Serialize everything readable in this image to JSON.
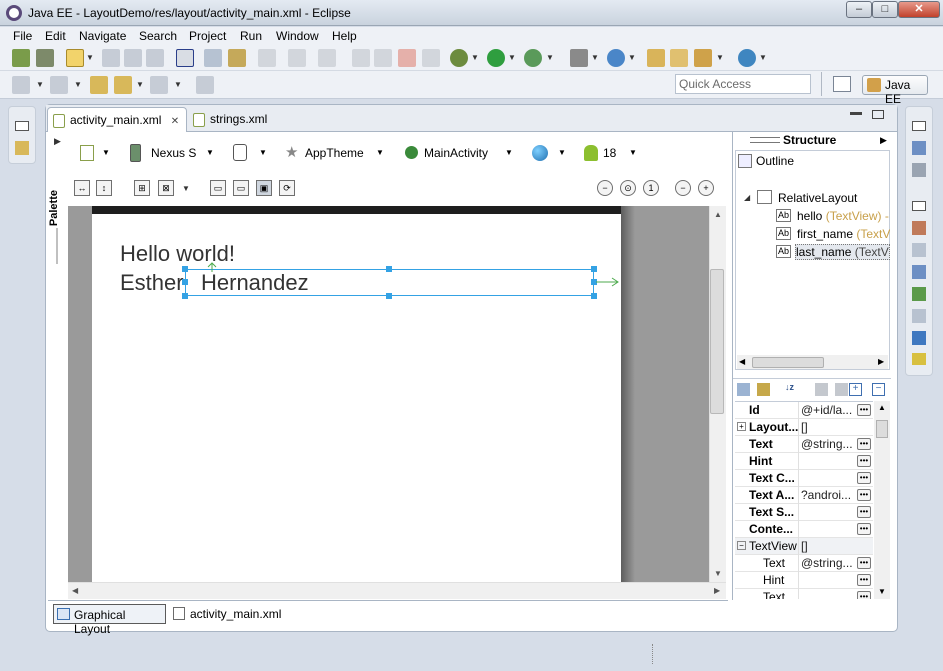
{
  "window": {
    "title": "Java EE - LayoutDemo/res/layout/activity_main.xml - Eclipse",
    "minimize": "–",
    "maximize": "□",
    "close": "✕"
  },
  "menu": [
    "File",
    "Edit",
    "Navigate",
    "Search",
    "Project",
    "Run",
    "Window",
    "Help"
  ],
  "toolbar": {
    "quick_access_placeholder": "Quick Access",
    "perspective": "Java EE"
  },
  "editor_tabs": [
    {
      "label": "activity_main.xml",
      "close": "✕"
    },
    {
      "label": "strings.xml"
    }
  ],
  "palette_label": "Palette",
  "config_bar": {
    "device": "Nexus S",
    "theme": "AppTheme",
    "activity": "MainActivity",
    "api_level": "18"
  },
  "canvas": {
    "hello": "Hello world!",
    "first_name": "Esther",
    "last_name": "Hernandez"
  },
  "bottom_tabs": [
    "Graphical Layout",
    "activity_main.xml"
  ],
  "structure": {
    "title": "Structure",
    "outline_title": "Outline",
    "root": "RelativeLayout",
    "children": [
      {
        "id": "hello",
        "type": "(TextView) -"
      },
      {
        "id": "first_name",
        "type": "(TextVi"
      },
      {
        "id": "last_name",
        "type": "(TextVi"
      }
    ]
  },
  "properties": [
    {
      "name": "Id",
      "value": "@+id/la...",
      "btn": true
    },
    {
      "name": "Layout...",
      "value": "[]",
      "expand": true
    },
    {
      "name": "Text",
      "value": "@string...",
      "btn": true
    },
    {
      "name": "Hint",
      "value": "",
      "btn": true
    },
    {
      "name": "Text C...",
      "value": "",
      "btn": true
    },
    {
      "name": "Text A...",
      "value": "?androi...",
      "btn": true
    },
    {
      "name": "Text S...",
      "value": "",
      "btn": true
    },
    {
      "name": "Conte...",
      "value": "",
      "btn": true
    },
    {
      "name": "TextView",
      "value": "[]",
      "expand": true,
      "section": true
    },
    {
      "name": "Text",
      "value": "@string...",
      "btn": true,
      "sub": true
    },
    {
      "name": "Hint",
      "value": "",
      "btn": true,
      "sub": true
    },
    {
      "name": "Text",
      "value": "",
      "btn": true,
      "sub": true
    }
  ]
}
